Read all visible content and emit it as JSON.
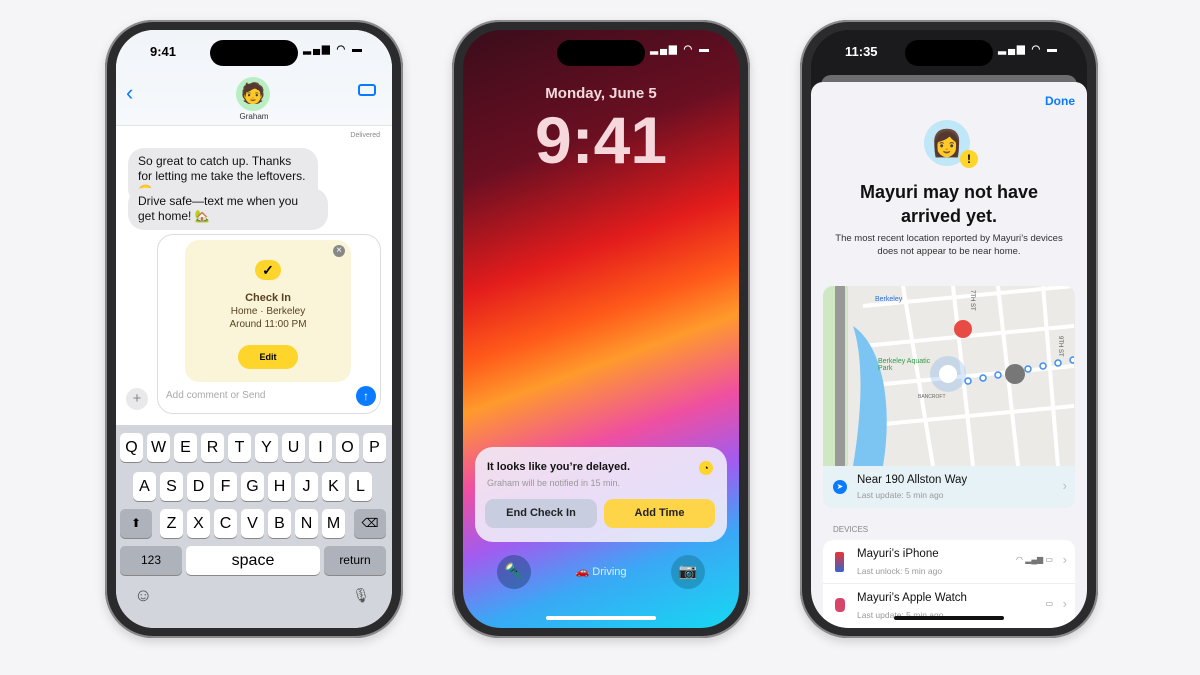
{
  "messages_phone": {
    "status_time": "9:41",
    "status_icons": "▂▄▆ ◠ ▬",
    "contact_name": "Graham",
    "back_icon": "chevron-left",
    "video_icon": "video-camera",
    "delivered": "Delivered",
    "messages": [
      "So great to catch up. Thanks for letting me take the leftovers. 😋",
      "Drive safe—text me when you get home! 🏡"
    ],
    "checkin_card": {
      "title": "Check In",
      "destination": "Home · Berkeley",
      "eta": "Around 11:00 PM",
      "edit_label": "Edit",
      "check": "✓",
      "close": "×"
    },
    "input_placeholder": "Add comment or Send",
    "plus": "+",
    "send": "↑",
    "keyboard": {
      "row1": [
        "Q",
        "W",
        "E",
        "R",
        "T",
        "Y",
        "U",
        "I",
        "O",
        "P"
      ],
      "row2": [
        "A",
        "S",
        "D",
        "F",
        "G",
        "H",
        "J",
        "K",
        "L"
      ],
      "row3": [
        "Z",
        "X",
        "C",
        "V",
        "B",
        "N",
        "M"
      ],
      "shift": "⬆",
      "delete": "⌫",
      "numbers": "123",
      "space": "space",
      "return": "return",
      "emoji": "☺",
      "mic": "🎙"
    }
  },
  "lock_phone": {
    "status_icons": "▂▄▆ ◠ ▬",
    "date": "Monday, June 5",
    "time": "9:41",
    "notification": {
      "title": "It looks like you’re delayed.",
      "subtitle": "Graham will be notified in 15 min.",
      "end_label": "End Check In",
      "add_label": "Add Time",
      "clock": "◔"
    },
    "focus_label": "Driving",
    "car": "🚗",
    "flashlight": "🔦",
    "camera": "📷"
  },
  "findmy_phone": {
    "status_time": "11:35",
    "status_icons": "▂▄▆ ◠ ▬",
    "done_label": "Done",
    "alert_badge": "!",
    "title": "Mayuri may not have arrived yet.",
    "description": "The most recent location reported by Mayuri’s devices does not appear to be near home.",
    "map_labels": {
      "station": "Berkeley",
      "park": "Berkeley Aquatic Park",
      "street1": "BANCROFT",
      "street2": "7TH ST",
      "street3": "9TH ST"
    },
    "location": {
      "title": "Near 190 Allston Way",
      "subtitle": "Last update: 5 min ago"
    },
    "devices_header": "DEVICES",
    "devices": [
      {
        "name": "Mayuri’s iPhone",
        "subtitle": "Last unlock: 5 min ago"
      },
      {
        "name": "Mayuri’s Apple Watch",
        "subtitle": "Last update: 5 min ago"
      }
    ],
    "chevron": "›"
  },
  "colors": {
    "accent": "#0a7aff",
    "yellow": "#fed52b",
    "card": "#faf5d9"
  }
}
